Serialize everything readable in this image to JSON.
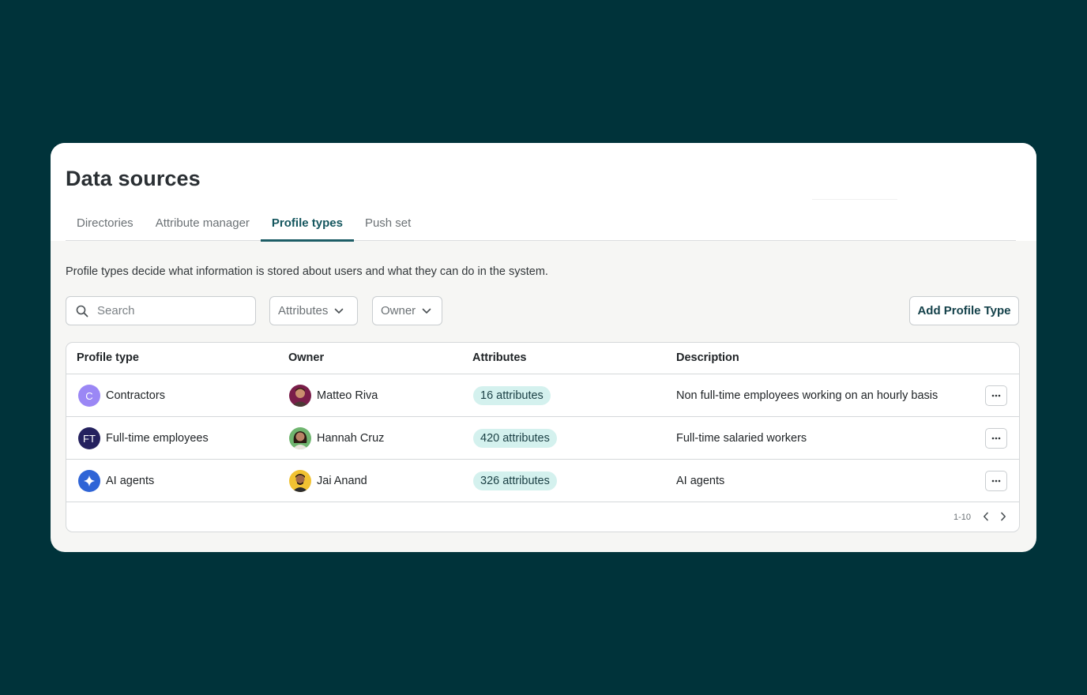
{
  "page": {
    "title": "Data sources",
    "description": "Profile types decide what information is stored about users and what they can do in the system."
  },
  "tabs": [
    {
      "label": "Directories",
      "active": false
    },
    {
      "label": "Attribute manager",
      "active": false
    },
    {
      "label": "Profile types",
      "active": true
    },
    {
      "label": "Push set",
      "active": false
    }
  ],
  "toolbar": {
    "search_placeholder": "Search",
    "filter_attributes": "Attributes",
    "filter_owner": "Owner",
    "add_button": "Add Profile Type"
  },
  "table": {
    "columns": [
      "Profile type",
      "Owner",
      "Attributes",
      "Description"
    ],
    "rows": [
      {
        "initial": "C",
        "icon_color": "#9b87f5",
        "type": "Contractors",
        "owner": "Matteo Riva",
        "attributes": "16 attributes",
        "description": "Non full-time employees working on an hourly basis"
      },
      {
        "initial": "FT",
        "icon_color": "#24215e",
        "type": "Full-time employees",
        "owner": "Hannah Cruz",
        "attributes": "420 attributes",
        "description": "Full-time salaried workers"
      },
      {
        "initial": "",
        "icon_name": "sparkle-icon",
        "icon_color": "#2f64d6",
        "type": "AI agents",
        "owner": "Jai Anand",
        "attributes": "326 attributes",
        "description": "AI agents"
      }
    ],
    "pagination": "1-10"
  },
  "colors": {
    "background": "#00333a",
    "accent": "#1d5d66",
    "badge_bg": "#d4f1ee"
  }
}
